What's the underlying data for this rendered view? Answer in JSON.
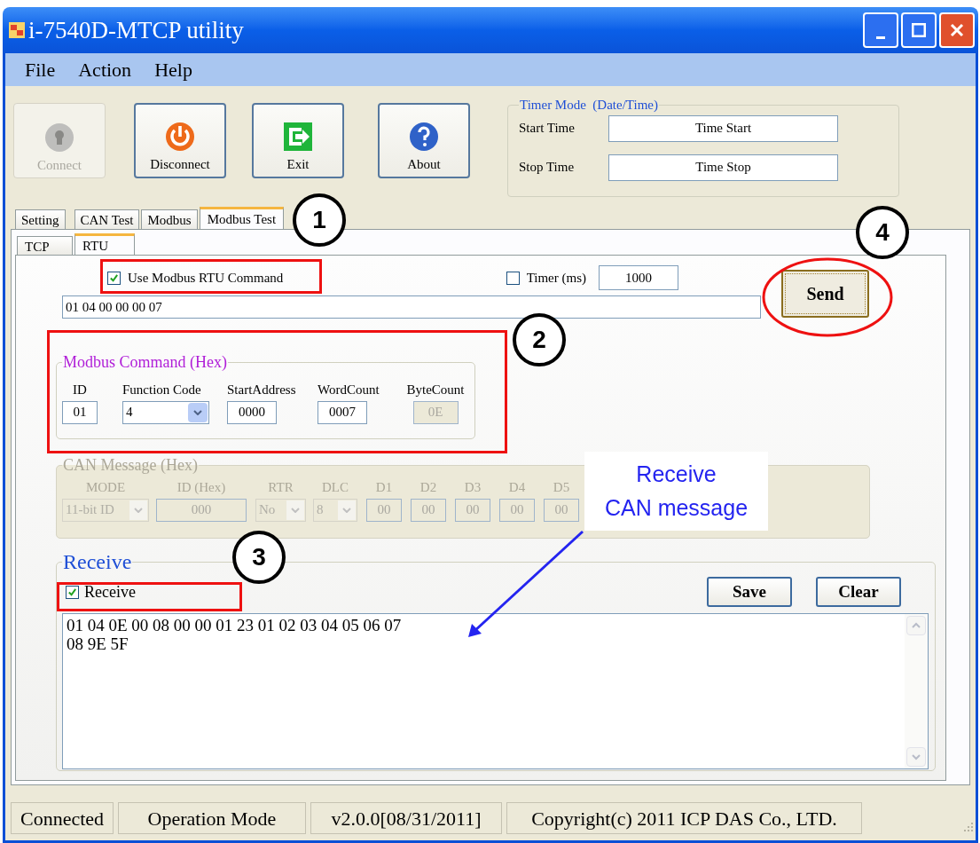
{
  "window": {
    "title": "i-7540D-MTCP utility"
  },
  "menu": [
    "File",
    "Action",
    "Help"
  ],
  "toolbar": [
    {
      "label": "Connect",
      "kind": "lock",
      "disabled": true
    },
    {
      "label": "Disconnect",
      "kind": "power",
      "disabled": false
    },
    {
      "label": "Exit",
      "kind": "exit",
      "disabled": false
    },
    {
      "label": "About",
      "kind": "help",
      "disabled": false
    }
  ],
  "timer_mode": {
    "title": "Timer Mode  (Date/Time)",
    "start_label": "Start Time",
    "start_value": "Time Start",
    "stop_label": "Stop Time",
    "stop_value": "Time Stop"
  },
  "tabs": [
    {
      "label": "Setting",
      "selected": false
    },
    {
      "label": "CAN Test",
      "selected": false
    },
    {
      "label": "Modbus",
      "selected": false
    },
    {
      "label": "Modbus Test",
      "selected": true
    }
  ],
  "subtabs": [
    {
      "label": "TCP",
      "selected": false
    },
    {
      "label": "RTU",
      "selected": true
    }
  ],
  "rtu": {
    "use_command": {
      "label": "Use Modbus RTU Command",
      "checked": true
    },
    "timer": {
      "label": "Timer (ms)",
      "checked": false,
      "value": "1000"
    },
    "command": "01 04 00 00 00 07",
    "send": "Send"
  },
  "modbus_command": {
    "title": "Modbus Command (Hex)",
    "fields": [
      {
        "label": "ID",
        "value": "01",
        "kind": "text",
        "disabled": false
      },
      {
        "label": "Function Code",
        "value": "4",
        "kind": "dropdown",
        "disabled": false
      },
      {
        "label": "StartAddress",
        "value": "0000",
        "kind": "text",
        "disabled": false
      },
      {
        "label": "WordCount",
        "value": "0007",
        "kind": "text",
        "disabled": false
      },
      {
        "label": "ByteCount",
        "value": "0E",
        "kind": "text",
        "disabled": true
      }
    ]
  },
  "can_message": {
    "title": "CAN Message (Hex)",
    "disabled": true,
    "fields": [
      {
        "label": "MODE",
        "value": "11-bit ID",
        "kind": "dropdown"
      },
      {
        "label": "ID (Hex)",
        "value": "000",
        "kind": "text"
      },
      {
        "label": "RTR",
        "value": "No",
        "kind": "dropdown"
      },
      {
        "label": "DLC",
        "value": "8",
        "kind": "dropdown"
      },
      {
        "label": "D1",
        "value": "00",
        "kind": "text"
      },
      {
        "label": "D2",
        "value": "00",
        "kind": "text"
      },
      {
        "label": "D3",
        "value": "00",
        "kind": "text"
      },
      {
        "label": "D4",
        "value": "00",
        "kind": "text"
      },
      {
        "label": "D5",
        "value": "00",
        "kind": "text"
      }
    ]
  },
  "receive": {
    "title": "Receive",
    "checkbox": {
      "label": "Receive",
      "checked": true
    },
    "buttons": [
      "Save",
      "Clear"
    ],
    "output": [
      "01 04 0E 00 08 00 00 01 23 01 02 03 04 05 06 07",
      "08 9E 5F"
    ]
  },
  "status_bar": [
    "Connected",
    "Operation Mode",
    "v2.0.0[08/31/2011]",
    "Copyright(c) 2011 ICP DAS Co., LTD."
  ],
  "annotations": {
    "markers": [
      "1",
      "2",
      "3",
      "4"
    ],
    "callout": "Receive\nCAN message"
  }
}
